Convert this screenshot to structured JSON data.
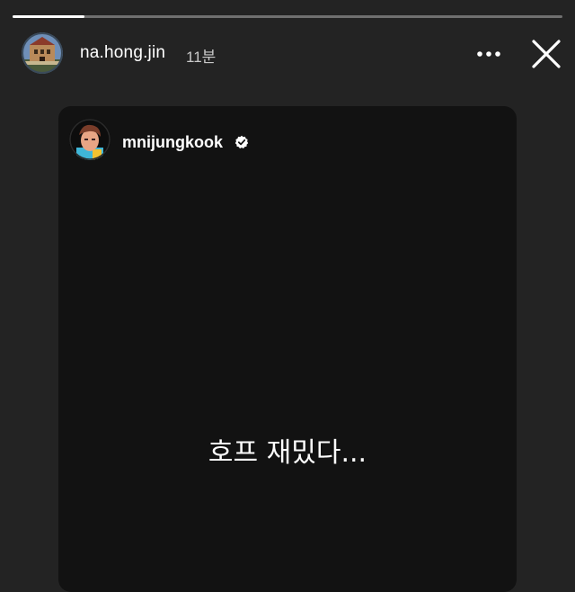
{
  "story": {
    "progress": 0.13,
    "username": "na.hong.jin",
    "timestamp": "11분",
    "avatar_icon": "profile-photo-building",
    "more_icon": "more-horizontal-icon",
    "close_icon": "close-icon"
  },
  "shared_post": {
    "username": "mnijungkook",
    "verified": true,
    "avatar_icon": "profile-photo-character",
    "text": "호프 재밌다..."
  },
  "colors": {
    "background": "#232323",
    "card_background": "#121212",
    "text": "#ffffff",
    "muted_text": "#c9c9c9"
  }
}
